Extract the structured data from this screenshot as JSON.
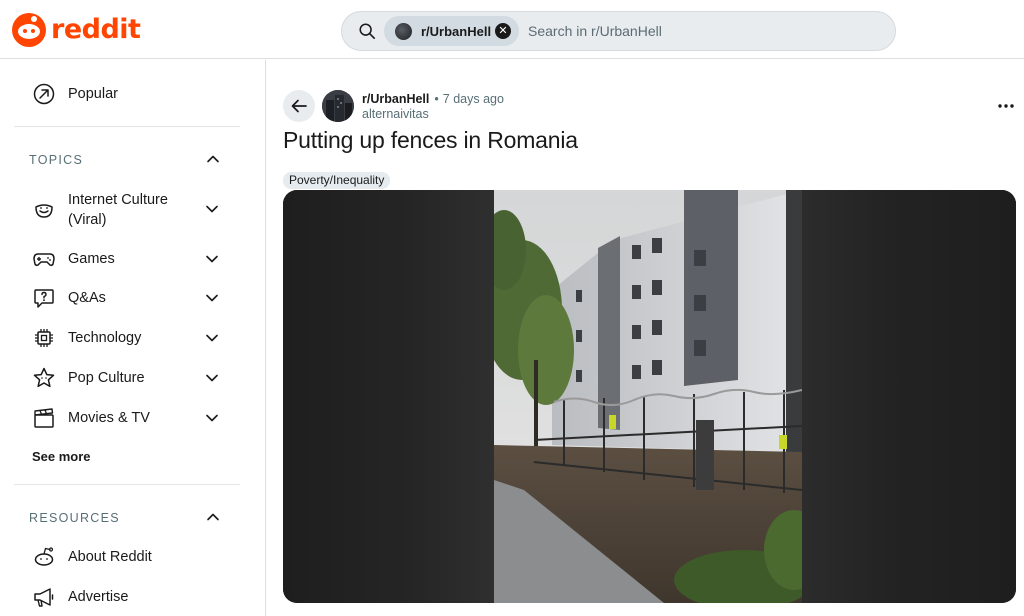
{
  "header": {
    "logo_text": "reddit",
    "brand_color": "#ff4500",
    "search": {
      "chip_label": "r/UrbanHell",
      "placeholder": "Search in r/UrbanHell",
      "value": ""
    }
  },
  "sidebar": {
    "top_items": [
      {
        "label": "Popular",
        "icon": "popular-arrow-icon"
      }
    ],
    "topics": {
      "heading": "TOPICS",
      "items": [
        {
          "label": "Internet Culture",
          "label2": "(Viral)",
          "icon": "smiley-icon"
        },
        {
          "label": "Games",
          "icon": "gamepad-icon"
        },
        {
          "label": "Q&As",
          "icon": "question-bubble-icon"
        },
        {
          "label": "Technology",
          "icon": "chip-icon"
        },
        {
          "label": "Pop Culture",
          "icon": "star-icon"
        },
        {
          "label": "Movies & TV",
          "icon": "clapperboard-icon"
        }
      ],
      "see_more": "See more"
    },
    "resources": {
      "heading": "RESOURCES",
      "items": [
        {
          "label": "About Reddit",
          "icon": "reddit-alien-icon"
        },
        {
          "label": "Advertise",
          "icon": "megaphone-icon"
        }
      ]
    }
  },
  "post": {
    "subreddit": "r/UrbanHell",
    "separator": "•",
    "time": "7 days ago",
    "author": "alternaivitas",
    "title": "Putting up fences in Romania",
    "flair": "Poverty/Inequality",
    "more_icon": "more-dots-icon",
    "back_icon": "back-arrow-icon"
  }
}
